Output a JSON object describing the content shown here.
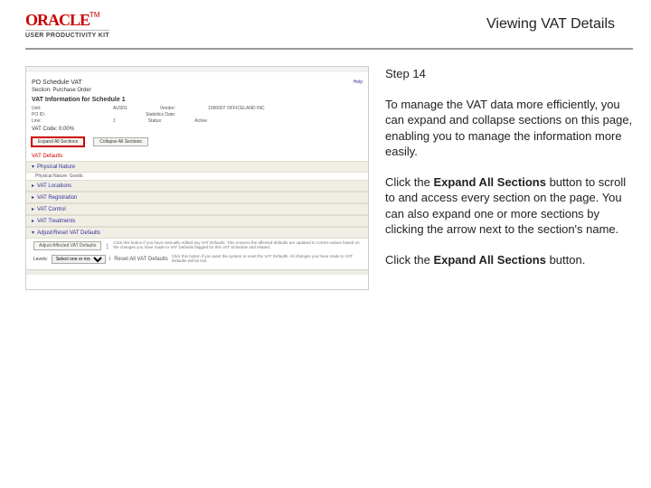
{
  "header": {
    "logo_text": "ORACLE",
    "tm": "TM",
    "upk": "USER PRODUCTIVITY KIT",
    "title": "Viewing VAT Details"
  },
  "instructions": {
    "step": "Step 14",
    "p1": "To manage the VAT data more efficiently, you can expand and collapse sections on this page, enabling you to manage the information more easily.",
    "p2_a": "Click the ",
    "p2_b": "Expand All Sections",
    "p2_c": " button to scroll to and access every section on the page. You can also expand one or more sections by clicking the arrow next to the section's name.",
    "p3_a": "Click the ",
    "p3_b": "Expand All Sections",
    "p3_c": " button."
  },
  "shot": {
    "po_sched": "PO Schedule VAT",
    "help": "Help",
    "sub": "Section: Purchase Order",
    "head": "VAT Information for Schedule 1",
    "kv": {
      "unit_l": "Unit:",
      "unit_v": "AUS01",
      "vendor_l": "Vendor:",
      "vendor_v": "1000007 OFFICELAND INC",
      "po_l": "PO ID:",
      "po_v": "",
      "date_l": "Statistics Date:",
      "line_l": "Line:",
      "line_v": "1",
      "status_l": "Status:",
      "status_v": "Active"
    },
    "rate": "VAT Code: 0.00%",
    "buttons": {
      "expand": "Expand All Sections",
      "collapse": "Collapse All Sections"
    },
    "sec_lead": "VAT Defaults",
    "sections": {
      "physical": "Physical Nature",
      "physical_val": "Physical Nature: Goods",
      "loc": "VAT Locations",
      "reg": "VAT Registration",
      "control": "VAT Control",
      "treat": "VAT Treatments",
      "adjreset": "Adjust/Reset VAT Defaults"
    },
    "adj": {
      "btn1": "Adjust Affected VAT Defaults",
      "t1": "Click this button if you have manually edited any VAT Defaults. This ensures the affected defaults are updated to correct values based on the changes you have made to VAT Defaults flagged for this VAT Schedule and related.",
      "lv_label": "Levels:",
      "lv_opt": "Select one or more levels",
      "btn2": "Reset All VAT Defaults",
      "t2": "Click this button if you want the system to reset the VAT Defaults. All changes you have made to VAT Defaults will be lost."
    }
  }
}
